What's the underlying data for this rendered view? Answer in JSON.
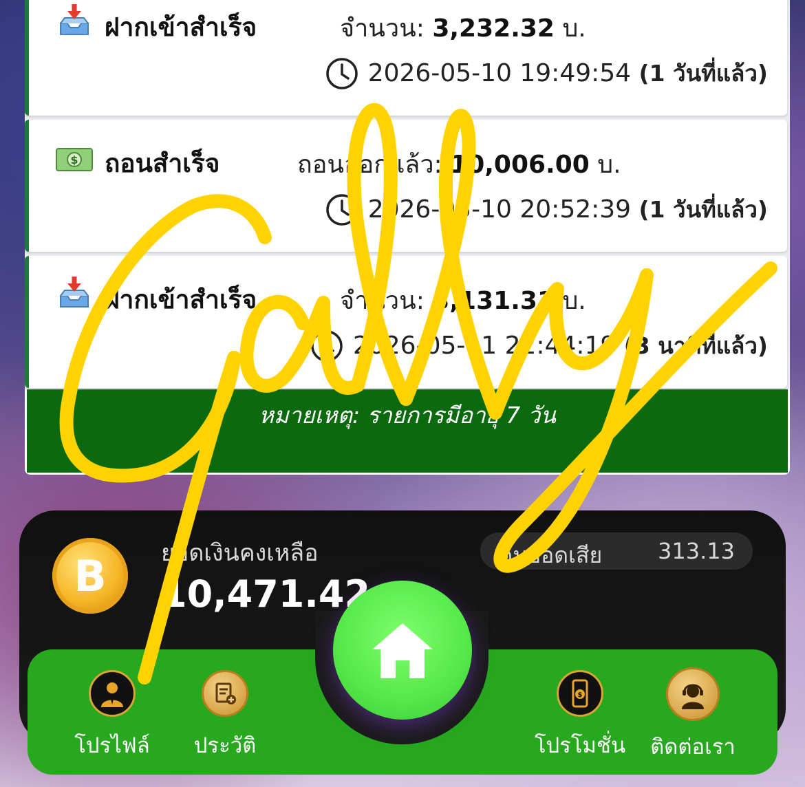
{
  "transactions": [
    {
      "title": "ฝากเข้าสำเร็จ",
      "amount_label": "จำนวน:",
      "amount": "3,232.32",
      "unit": "บ.",
      "time": "2026-05-10 19:49:54",
      "ago": "(1 วันที่แล้ว)",
      "icon": "inbox-tray-icon"
    },
    {
      "title": "ถอนสำเร็จ",
      "amount_label": "ถอนออกแล้ว:",
      "amount": "10,006.00",
      "unit": "บ.",
      "time": "2026-05-10 20:52:39",
      "ago": "(1 วันที่แล้ว)",
      "icon": "dollar-banknote-icon"
    },
    {
      "title": "ฝากเข้าสำเร็จ",
      "amount_label": "จำนวน:",
      "amount": "3,131.31",
      "unit": "บ.",
      "time": "2026-05-11 22:44:19",
      "ago": "(3 นาทีที่แล้ว)",
      "icon": "inbox-tray-icon"
    }
  ],
  "note": "หมายเหตุ: รายการมีอายุ 7 วัน",
  "wallet": {
    "balance_label": "ยอดเงินคงเหลือ",
    "balance": "10,471.42",
    "refund_label": "คืนยอดเสีย",
    "refund_value": "313.13",
    "coin_symbol": "B"
  },
  "nav": {
    "profile": "โปรไฟล์",
    "history": "ประวัติ",
    "promotion": "โปรโมชั่น",
    "contact": "ติดต่อเรา"
  },
  "colors": {
    "card_accent": "#1f7a3a",
    "note_bg": "#0a6a0d",
    "nav_bg": "#27a81f",
    "home_button": "#55e84a",
    "scribble": "#ffd200"
  },
  "overlay_signature": "Gally"
}
